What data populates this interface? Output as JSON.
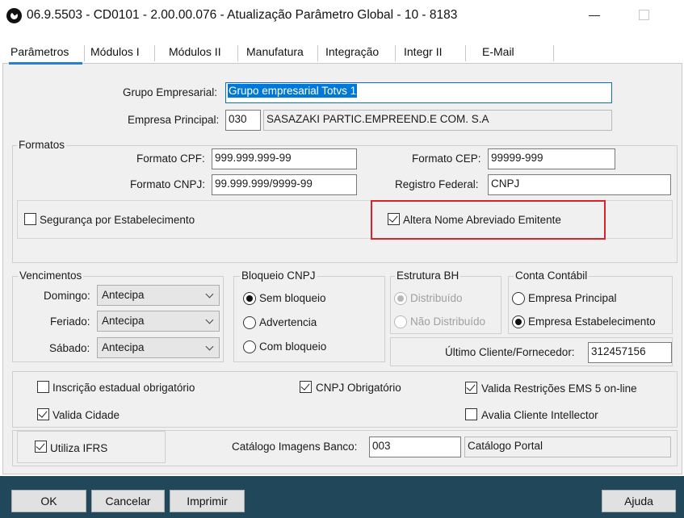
{
  "window": {
    "title": "06.9.5503 - CD0101 - 2.00.00.076 - Atualização Parâmetro Global - 10 - 8183"
  },
  "tabs": [
    {
      "label": "Parâmetros",
      "active": true
    },
    {
      "label": "Módulos I"
    },
    {
      "label": "Módulos II"
    },
    {
      "label": "Manufatura"
    },
    {
      "label": "Integração"
    },
    {
      "label": "Integr II"
    },
    {
      "label": "E-Mail"
    }
  ],
  "empresa": {
    "grupo_label": "Grupo Empresarial:",
    "grupo_value": "Grupo empresarial Totvs 1",
    "principal_label": "Empresa Principal:",
    "principal_code": "030",
    "principal_name": "SASAZAKI PARTIC.EMPREEND.E COM. S.A"
  },
  "formatos": {
    "legend": "Formatos",
    "cpf_label": "Formato CPF:",
    "cpf_value": "999.999.999-99",
    "cep_label": "Formato CEP:",
    "cep_value": "99999-999",
    "cnpj_label": "Formato CNPJ:",
    "cnpj_value": "99.999.999/9999-99",
    "registro_label": "Registro Federal:",
    "registro_value": "CNPJ",
    "seguranca_label": "Segurança por Estabelecimento",
    "seguranca_checked": false,
    "altera_label": "Altera Nome Abreviado Emitente",
    "altera_checked": true
  },
  "vencimentos": {
    "legend": "Vencimentos",
    "rows": [
      {
        "label": "Domingo:",
        "value": "Antecipa"
      },
      {
        "label": "Feriado:",
        "value": "Antecipa"
      },
      {
        "label": "Sábado:",
        "value": "Antecipa"
      }
    ]
  },
  "bloqueio": {
    "legend": "Bloqueio CNPJ",
    "options": [
      {
        "label": "Sem bloqueio",
        "selected": true
      },
      {
        "label": "Advertencia",
        "selected": false
      },
      {
        "label": "Com bloqueio",
        "selected": false
      }
    ]
  },
  "estrutura": {
    "legend": "Estrutura BH",
    "options": [
      {
        "label": "Distribuído",
        "selected": true
      },
      {
        "label": "Não Distribuído",
        "selected": false
      }
    ]
  },
  "conta": {
    "legend": "Conta Contábil",
    "options": [
      {
        "label": "Empresa Principal",
        "selected": false
      },
      {
        "label": "Empresa Estabelecimento",
        "selected": true
      }
    ],
    "ultimo_label": "Último Cliente/Fornecedor:",
    "ultimo_value": "312457156"
  },
  "flags": {
    "inscricao_label": "Inscrição estadual obrigatório",
    "cnpj_obrig_label": "CNPJ Obrigatório",
    "valida_restricoes_label": "Valida Restrições EMS 5 on-line",
    "valida_cidade_label": "Valida Cidade",
    "avalia_label": "Avalia Cliente Intellector",
    "ifrs_label": "Utiliza IFRS"
  },
  "catalogo": {
    "banco_label": "Catálogo Imagens Banco:",
    "banco_value": "003",
    "portal_label": "Catálogo Portal"
  },
  "buttons": {
    "ok": "OK",
    "cancelar": "Cancelar",
    "imprimir": "Imprimir",
    "ajuda": "Ajuda"
  },
  "colors": {
    "accent": "#2a7fd4",
    "highlight": "#d8232a",
    "bottom_bar": "#21475b"
  }
}
